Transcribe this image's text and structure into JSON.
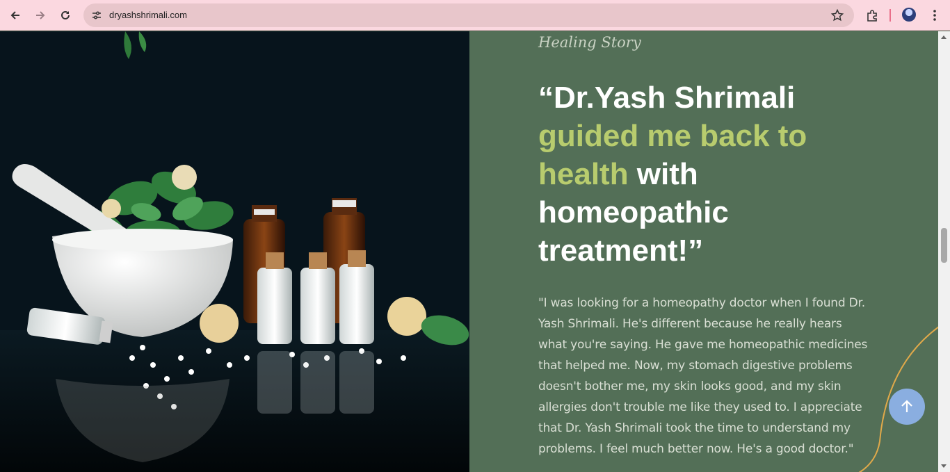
{
  "browser": {
    "url": "dryashshrimali.com",
    "icons": {
      "back": "arrow-left-icon",
      "forward": "arrow-right-icon",
      "reload": "reload-icon",
      "site_settings": "tune-icon",
      "bookmark": "star-icon",
      "extensions": "puzzle-icon",
      "profile": "avatar",
      "menu": "kebab-menu-icon"
    }
  },
  "section": {
    "eyebrow": "Healing Story",
    "quote_part1": "“Dr.Yash Shrimali ",
    "quote_accent": "guided me back to health",
    "quote_part2": " with homeopathic treatment!”",
    "testimonial": "\"I was looking for a homeopathy doctor when I found Dr. Yash Shrimali. He's different because he really hears what you're saying. He gave me homeopathic medicines that helped me. Now, my stomach digestive problems doesn't bother me, my skin looks good, and my skin allergies don't trouble me like they used to. I appreciate that Dr. Yash Shrimali took the time to understand my problems. I feel much better now. He's a good doctor.\""
  },
  "hero_image": {
    "description_icon": "homeopathy-image"
  },
  "colors": {
    "chrome_bg": "#fbd8e0",
    "panel_bg": "#536f57",
    "accent": "#b8cc6e",
    "scroll_top_button": "#8aaee0",
    "arc": "#e0a94a"
  }
}
